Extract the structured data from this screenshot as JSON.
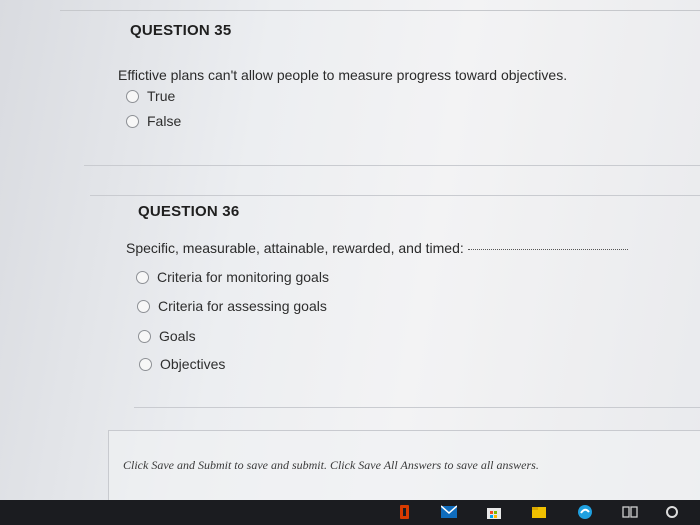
{
  "questions": [
    {
      "title": "QUESTION 35",
      "text": "Effictive plans can't allow people to measure progress toward objectives.",
      "options": [
        "True",
        "False"
      ]
    },
    {
      "title": "QUESTION 36",
      "text": "Specific, measurable, attainable, rewarded, and timed:",
      "options": [
        "Criteria for monitoring goals",
        "Criteria for assessing goals",
        "Goals",
        "Objectives"
      ]
    }
  ],
  "footer": {
    "instructions": "Click Save and Submit to save and submit. Click Save All Answers to save all answers."
  },
  "taskbar": {
    "icons": [
      "office-icon",
      "mail-icon",
      "store-icon",
      "files-icon",
      "edge-icon",
      "task-view-icon",
      "cortana-icon"
    ],
    "colors": {
      "office": "#d83b01",
      "mail": "#0f6cbd",
      "store": "#e8e8e8",
      "files": "#f0c000",
      "edge": "#1fa0e0"
    }
  }
}
